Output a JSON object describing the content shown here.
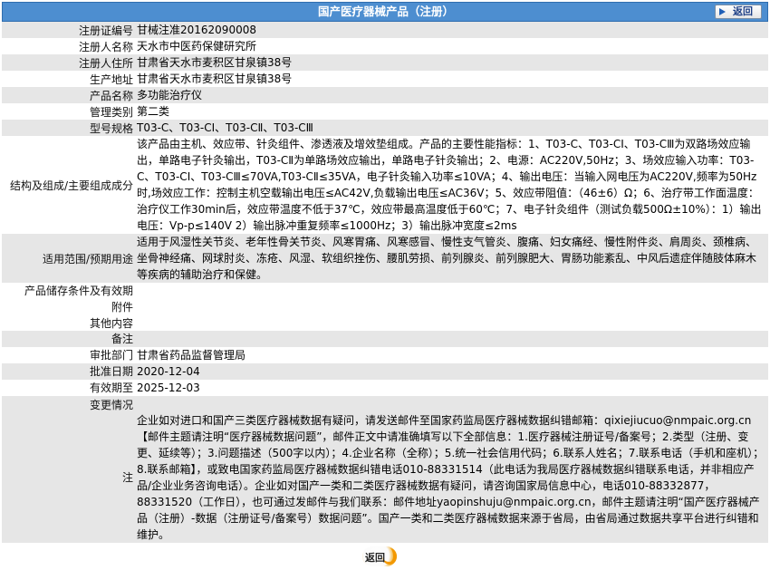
{
  "header": {
    "title": "国产医疗器械产品（注册）",
    "back_label": "返回"
  },
  "rows": {
    "reg_no": {
      "label": "注册证编号",
      "value": "甘械注准20162090008"
    },
    "registrant": {
      "label": "注册人名称",
      "value": "天水市中医药保健研究所"
    },
    "residence": {
      "label": "注册人住所",
      "value": "甘肃省天水市麦积区甘泉镇38号"
    },
    "production": {
      "label": "生产地址",
      "value": "甘肃省天水市麦积区甘泉镇38号"
    },
    "product_name": {
      "label": "产品名称",
      "value": "多功能治疗仪"
    },
    "category": {
      "label": "管理类别",
      "value": "第二类"
    },
    "model": {
      "label": "型号规格",
      "value": "T03-C、T03-CI、T03-CⅡ、T03-CⅢ"
    },
    "structure": {
      "label": "结构及组成/主要组成成分",
      "value": "该产品由主机、效应带、针灸组件、渗透液及增效垫组成。产品的主要性能指标：1、T03-C、T03-CI、T03-CⅢ为双路场效应输出，单路电子针灸输出，T03-CⅡ为单路场效应输出，单路电子针灸输出；2、电源：AC220V,50Hz；3、场效应输入功率：T03-C、T03-CI、T03-CⅢ≤70VA,T03-CⅡ≤35VA，电子针灸输入功率≤10VA；4、输出电压：当输入网电压为AC220V,频率为50Hz时,场效应工作：控制主机空载输出电压≤AC42V,负载输出电压≤AC36V；5、效应带阻值：（46±6）Ω；6、治疗带工作面温度：治疗仪工作30min后，效应带温度不低于37℃，效应带最高温度低于60℃；7、电子针灸组件（测试负载500Ω±10%）：1）输出电压：Vp-p≤140V 2）输出脉冲重复频率≤1000Hz；3）输出脉冲宽度≤2ms"
    },
    "scope": {
      "label": "适用范围/预期用途",
      "value": "适用于风湿性关节炎、老年性骨关节炎、风寒胃痛、风寒感冒、慢性支气管炎、腹痛、妇女痛经、慢性附件炎、肩周炎、颈椎病、坐骨神经痛、网球肘炎、冻疮、风湿、软组织挫伤、腰肌劳损、前列腺炎、前列腺肥大、胃肠功能紊乱、中风后遗症伴随肢体麻木等疾病的辅助治疗和保健。"
    },
    "storage": {
      "label": "产品储存条件及有效期",
      "value": ""
    },
    "attachment": {
      "label": "附件",
      "value": ""
    },
    "other": {
      "label": "其他内容",
      "value": ""
    },
    "remark": {
      "label": "备注",
      "value": ""
    },
    "approver": {
      "label": "审批部门",
      "value": "甘肃省药品监督管理局"
    },
    "approve_date": {
      "label": "批准日期",
      "value": "2020-12-04"
    },
    "valid_until": {
      "label": "有效期至",
      "value": "2025-12-03"
    },
    "change": {
      "label": "变更情况",
      "value": ""
    },
    "note": {
      "label": "注",
      "value": "企业如对进口和国产三类医疗器械数据有疑问，请发送邮件至国家药监局医疗器械数据纠错邮箱：qixiejiucuo@nmpaic.org.cn【邮件主题请注明“医疗器械数据问题”，邮件正文中请准确填写以下全部信息：1.医疗器械注册证号/备案号；2.类型（注册、变更、延续等）；3.问题描述（500字以内）；4.企业名称（全称）；5.统一社会信用代码；6.联系人姓名；7.联系电话（手机和座机）；8.联系邮箱】，或致电国家药监局医疗器械数据纠错电话010-88331514（此电话为我局医疗器械数据纠错联系电话，并非相应产品/企业业务咨询电话）。企业如对国产一类和二类医疗器械数据有疑问，请咨询国家局信息中心，电话010-88332877，88331520（工作日），也可通过发邮件与我们联系：邮件地址yaopinshuju@nmpaic.org.cn，邮件主题请注明“国产医疗器械产品（注册）-数据（注册证号/备案号）数据问题”。国产一类和二类医疗器械数据来源于省局，由省局通过数据共享平台进行纠错和维护。"
    }
  },
  "footer": {
    "back_label": "返回"
  },
  "colors": {
    "header_bg": "#4d8ed0",
    "row_alt": "#e6e6e6",
    "back_accent": "#f39800"
  }
}
